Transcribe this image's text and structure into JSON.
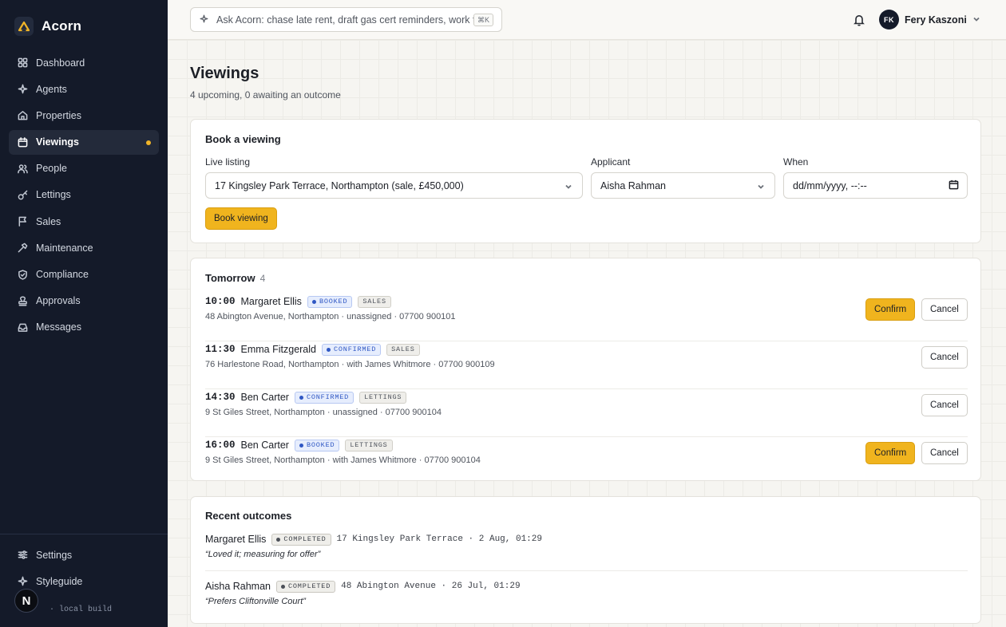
{
  "brand": {
    "name": "Acorn"
  },
  "sidebar": {
    "items": [
      {
        "label": "Dashboard",
        "icon": "grid-icon"
      },
      {
        "label": "Agents",
        "icon": "sparkle-icon"
      },
      {
        "label": "Properties",
        "icon": "home-icon"
      },
      {
        "label": "Viewings",
        "icon": "calendar-icon",
        "active": true
      },
      {
        "label": "People",
        "icon": "users-icon"
      },
      {
        "label": "Lettings",
        "icon": "key-icon"
      },
      {
        "label": "Sales",
        "icon": "flag-icon"
      },
      {
        "label": "Maintenance",
        "icon": "hammer-icon"
      },
      {
        "label": "Compliance",
        "icon": "shield-icon"
      },
      {
        "label": "Approvals",
        "icon": "stamp-icon"
      },
      {
        "label": "Messages",
        "icon": "inbox-icon"
      }
    ],
    "bottom_items": [
      {
        "label": "Settings",
        "icon": "sliders-icon"
      },
      {
        "label": "Styleguide",
        "icon": "sparkle-icon"
      }
    ],
    "build_note": "· local build",
    "badge_letter": "N"
  },
  "topbar": {
    "ask_placeholder": "Ask Acorn: chase late rent, draft gas cert reminders, work th",
    "shortcut": "⌘K",
    "user": {
      "initials": "FK",
      "name": "Fery Kaszoni"
    }
  },
  "page": {
    "title": "Viewings",
    "subtitle": "4 upcoming, 0 awaiting an outcome"
  },
  "booking": {
    "title": "Book a viewing",
    "listing_label": "Live listing",
    "listing_value": "17 Kingsley Park Terrace, Northampton (sale, £450,000)",
    "applicant_label": "Applicant",
    "applicant_value": "Aisha Rahman",
    "when_label": "When",
    "when_placeholder": "dd/mm/yyyy, --:--",
    "submit_label": "Book viewing"
  },
  "schedule": {
    "title": "Tomorrow",
    "count": "4",
    "confirm_label": "Confirm",
    "cancel_label": "Cancel",
    "rows": [
      {
        "time": "10:00",
        "name": "Margaret Ellis",
        "status": "BOOKED",
        "type": "SALES",
        "details": "48 Abington Avenue, Northampton · unassigned · 07700 900101",
        "can_confirm": true
      },
      {
        "time": "11:30",
        "name": "Emma Fitzgerald",
        "status": "CONFIRMED",
        "type": "SALES",
        "details": "76 Harlestone Road, Northampton · with James Whitmore · 07700 900109",
        "can_confirm": false
      },
      {
        "time": "14:30",
        "name": "Ben Carter",
        "status": "CONFIRMED",
        "type": "LETTINGS",
        "details": "9 St Giles Street, Northampton · unassigned · 07700 900104",
        "can_confirm": false
      },
      {
        "time": "16:00",
        "name": "Ben Carter",
        "status": "BOOKED",
        "type": "LETTINGS",
        "details": "9 St Giles Street, Northampton · with James Whitmore · 07700 900104",
        "can_confirm": true
      }
    ]
  },
  "outcomes": {
    "title": "Recent outcomes",
    "rows": [
      {
        "name": "Margaret Ellis",
        "status": "COMPLETED",
        "meta": "17 Kingsley Park Terrace · 2 Aug, 01:29",
        "quote": "“Loved it; measuring for offer”"
      },
      {
        "name": "Aisha Rahman",
        "status": "COMPLETED",
        "meta": "48 Abington Avenue · 26 Jul, 01:29",
        "quote": "“Prefers Cliftonville Court”"
      }
    ]
  },
  "colors": {
    "sidebar_bg": "#141a29",
    "accent": "#f0b41e",
    "status_blue": "#2f57c4"
  }
}
